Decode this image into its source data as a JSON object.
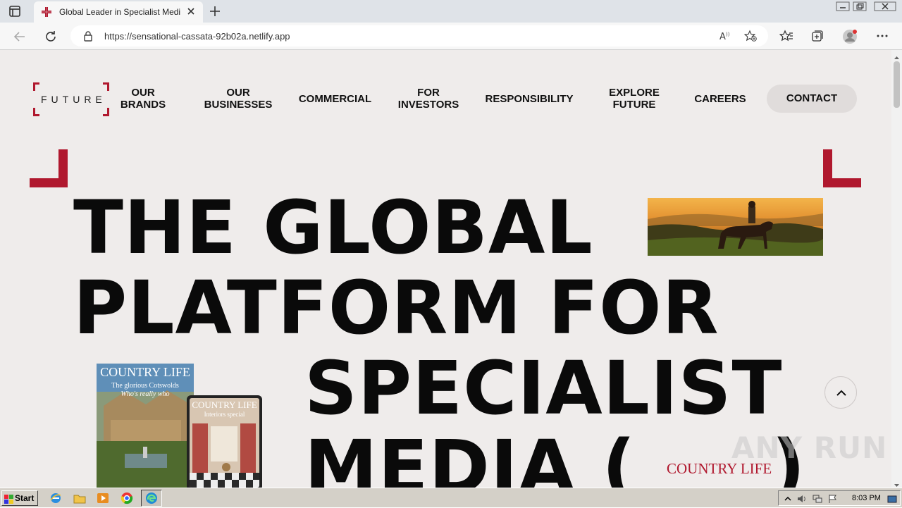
{
  "browser": {
    "tab_title": "Global Leader in Specialist Media",
    "url": "https://sensational-cassata-92b02a.netlify.app",
    "icons": [
      "tab-actions-icon",
      "future-favicon",
      "close-icon",
      "new-tab-icon",
      "back-icon",
      "refresh-icon",
      "lock-icon",
      "read-aloud-icon",
      "add-favorite-icon",
      "favorites-icon",
      "collections-icon",
      "profile-icon",
      "more-icon",
      "minimize-icon",
      "restore-icon",
      "close-window-icon"
    ]
  },
  "site": {
    "logo_text": "FUTURE",
    "nav": [
      {
        "label": "OUR BRANDS"
      },
      {
        "label": "OUR BUSINESSES"
      },
      {
        "label": "COMMERCIAL"
      },
      {
        "label": "FOR INVESTORS"
      },
      {
        "label": "RESPONSIBILITY"
      },
      {
        "label": "EXPLORE FUTURE"
      },
      {
        "label": "CAREERS"
      }
    ],
    "contact_label": "CONTACT",
    "hero": {
      "line1": "THE GLOBAL",
      "line2": "PLATFORM FOR",
      "line3": "SPECIALIST",
      "line4": "MEDIA ("
    },
    "magazine": {
      "title": "COUNTRY LIFE",
      "cover_line": "The glorious Cotswolds",
      "cover_sub": "Who's really who",
      "tablet_title": "COUNTRY LIFE",
      "tablet_line": "Interiors special"
    },
    "brand_logo": "COUNTRY LIFE",
    "accent_color": "#b0182e",
    "bg_color": "#efeceb"
  },
  "watermark": "ANY RUN",
  "taskbar": {
    "start_label": "Start",
    "clock": "8:03 PM"
  }
}
